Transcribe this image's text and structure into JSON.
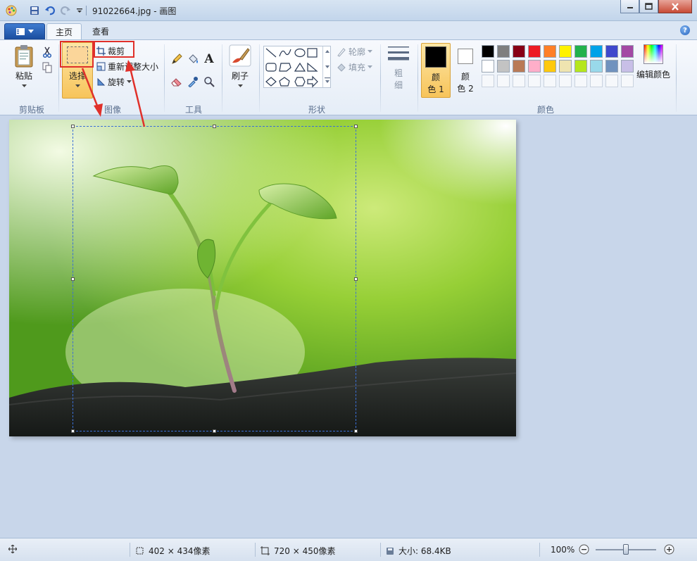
{
  "window": {
    "title": "91022664.jpg - 画图"
  },
  "tabs": [
    {
      "label": "主页",
      "active": true
    },
    {
      "label": "查看",
      "active": false
    }
  ],
  "ribbon": {
    "clipboard": {
      "paste_label": "粘贴",
      "group_label": "剪贴板"
    },
    "image": {
      "select_label": "选择",
      "crop_label": "裁剪",
      "resize_label": "重新调整大小",
      "rotate_label": "旋转",
      "group_label": "图像"
    },
    "tools": {
      "group_label": "工具",
      "text_tool_glyph": "A"
    },
    "brushes": {
      "label": "刷子"
    },
    "shapes": {
      "outline_label": "轮廓",
      "fill_label": "填充",
      "group_label": "形状"
    },
    "size": {
      "label_line1": "粗",
      "label_line2": "细"
    },
    "colors": {
      "color1_line1": "颜",
      "color1_line2": "色 1",
      "color2_line1": "颜",
      "color2_line2": "色 2",
      "edit_label": "编辑颜色",
      "group_label": "颜色",
      "color1_value": "#000000",
      "color2_value": "#ffffff",
      "palette_row1": [
        "#000000",
        "#7f7f7f",
        "#880015",
        "#ed1c24",
        "#ff7f27",
        "#fff200",
        "#22b14c",
        "#00a2e8",
        "#3f48cc",
        "#a349a4"
      ],
      "palette_row2": [
        "#ffffff",
        "#c3c3c3",
        "#b97a57",
        "#ffaec9",
        "#ffc90e",
        "#efe4b0",
        "#b5e61d",
        "#99d9ea",
        "#7092be",
        "#c8bfe7"
      ]
    }
  },
  "status": {
    "selection_size": "402 × 434像素",
    "image_size": "720 × 450像素",
    "file_size": "大小: 68.4KB",
    "zoom": "100%",
    "zoom_level": 0.5
  }
}
